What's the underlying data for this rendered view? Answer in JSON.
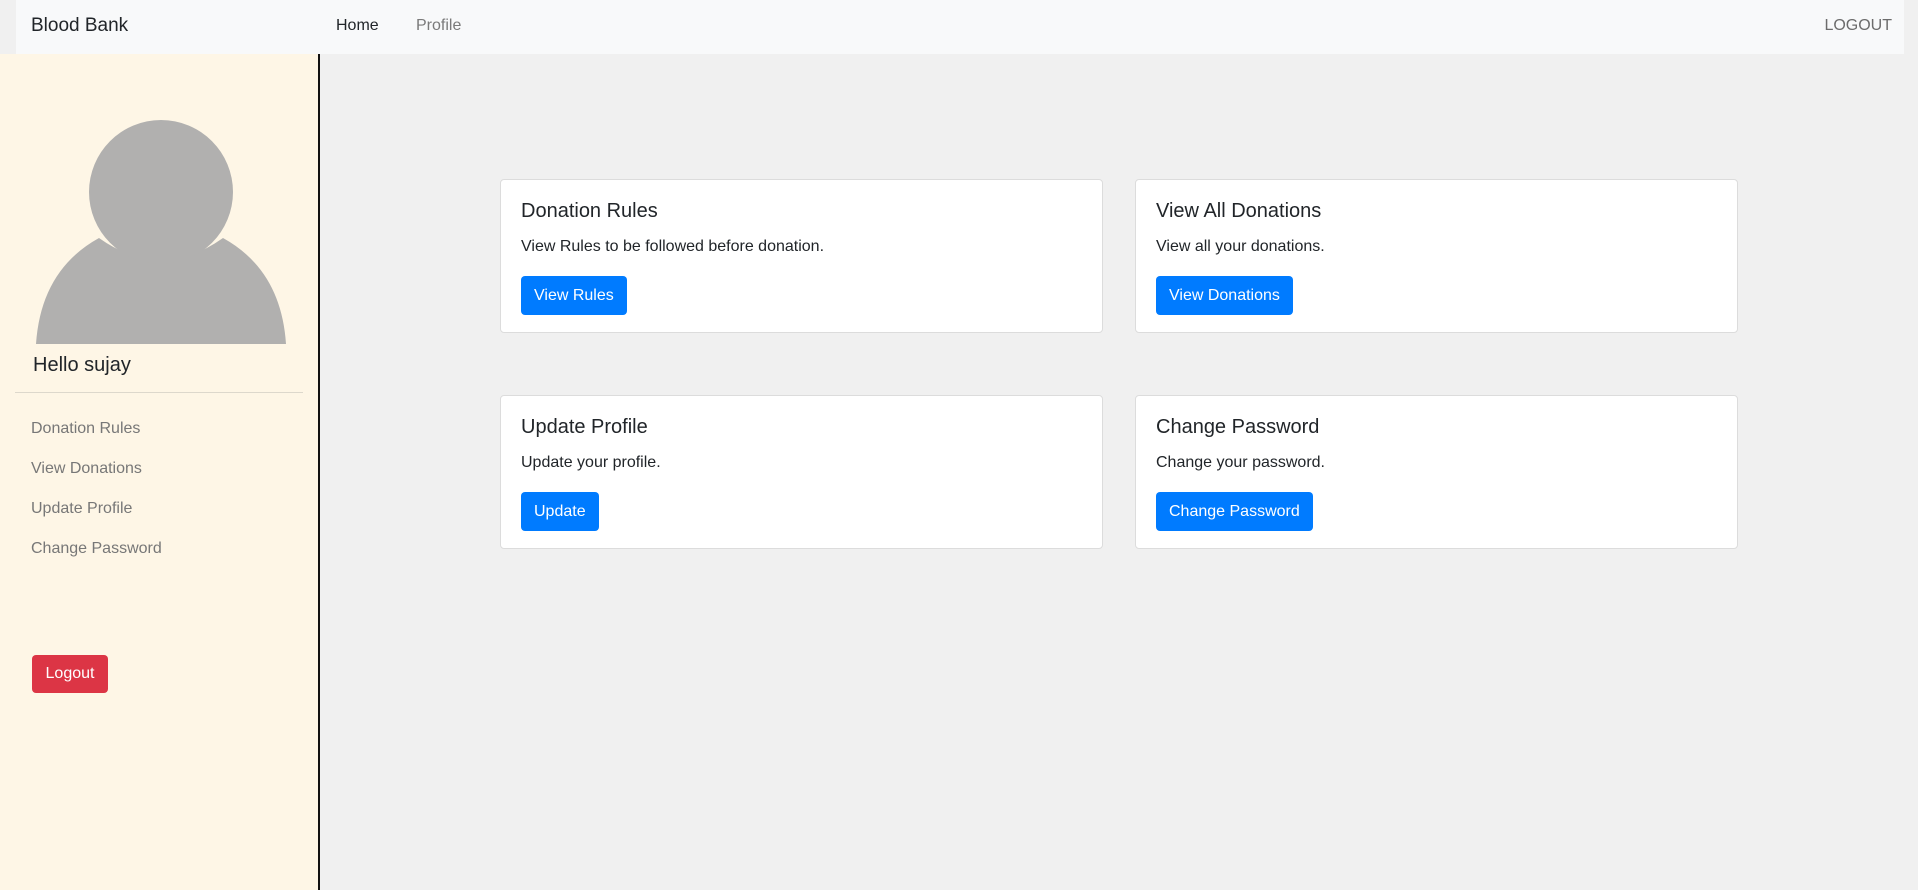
{
  "navbar": {
    "brand": "Blood Bank",
    "links": [
      {
        "label": "Home"
      },
      {
        "label": "Profile"
      }
    ],
    "logout": "LOGOUT"
  },
  "sidebar": {
    "greeting": "Hello sujay",
    "items": [
      {
        "label": "Donation Rules"
      },
      {
        "label": "View Donations"
      },
      {
        "label": "Update Profile"
      },
      {
        "label": "Change Password"
      }
    ],
    "logout_button": "Logout"
  },
  "cards": [
    {
      "title": "Donation Rules",
      "text": "View Rules to be followed before donation.",
      "button": "View Rules"
    },
    {
      "title": "View All Donations",
      "text": "View all your donations.",
      "button": "View Donations"
    },
    {
      "title": "Update Profile",
      "text": "Update your profile.",
      "button": "Update"
    },
    {
      "title": "Change Password",
      "text": "Change your password.",
      "button": "Change Password"
    }
  ],
  "colors": {
    "primary": "#007bff",
    "danger": "#dc3545",
    "sidebar_bg": "#fef6e6",
    "page_bg": "#f0f0f0",
    "avatar": "#b1b0af"
  }
}
